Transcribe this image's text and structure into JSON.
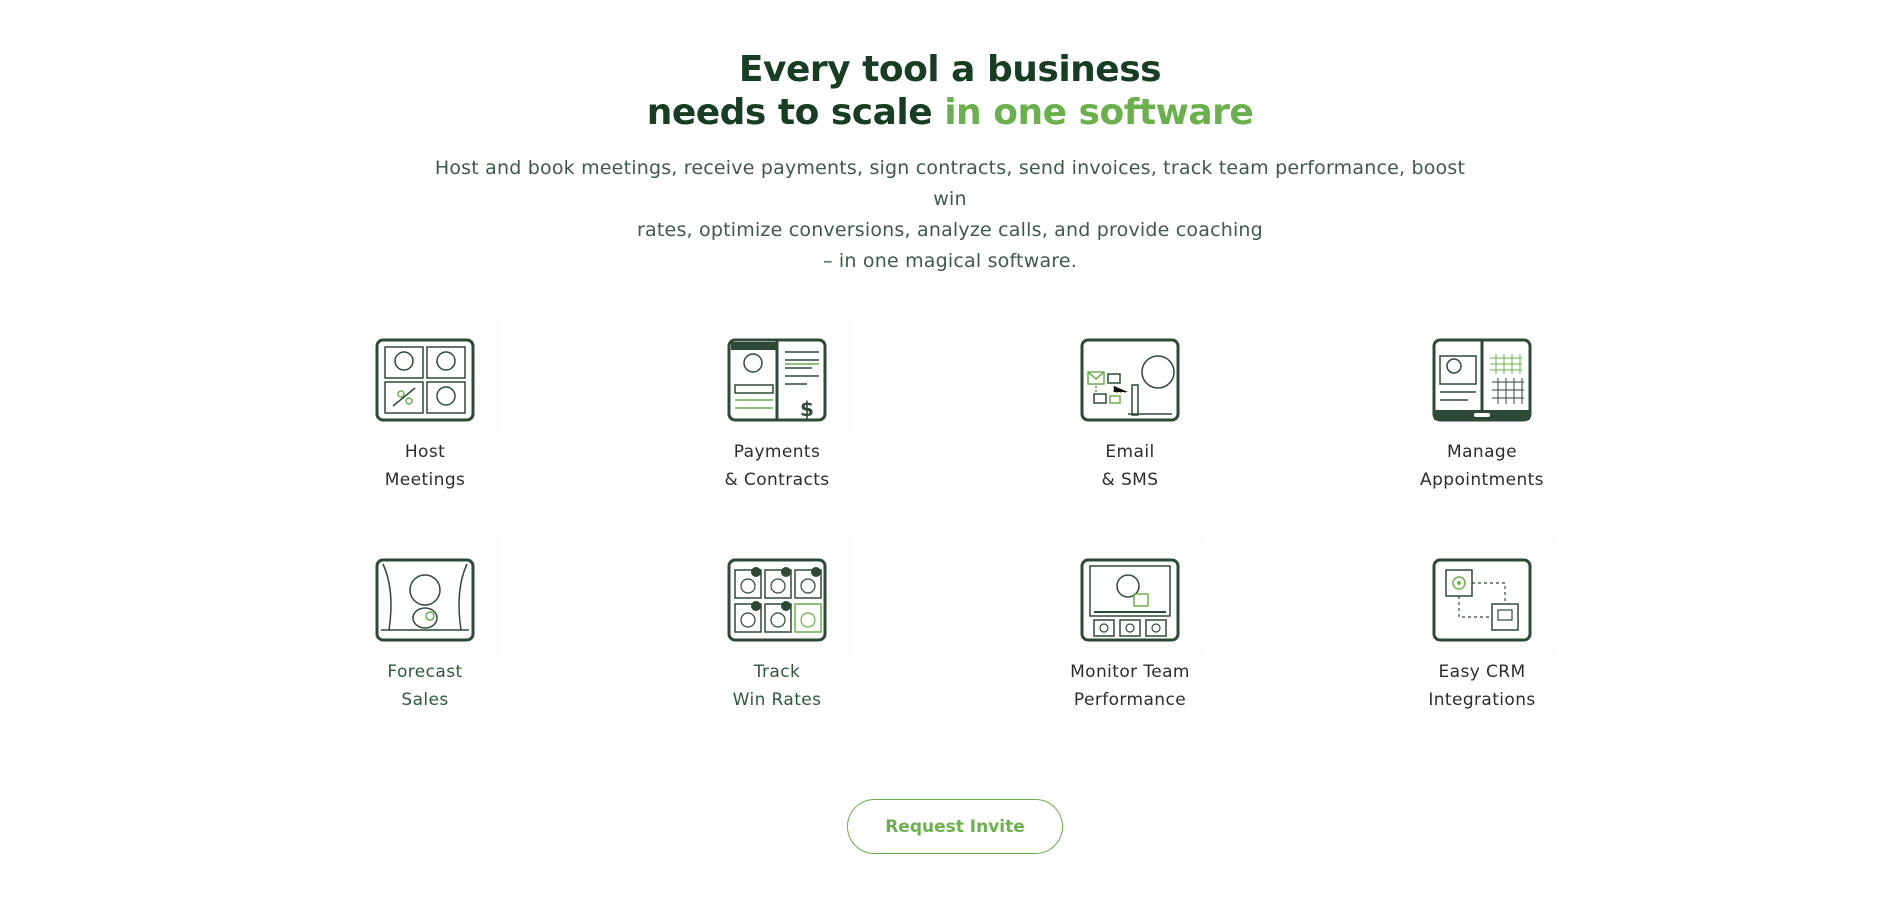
{
  "heading": {
    "line1": "Every tool a business",
    "line2_main": "needs to scale ",
    "line2_accent": "in one software"
  },
  "subtitle": {
    "line1": "Host and book meetings, receive payments, sign contracts, send invoices, track team performance, boost win",
    "line2": "rates, optimize conversions, analyze calls, and provide coaching",
    "line3": "– in one magical software."
  },
  "features": [
    {
      "icon": "host-meetings-icon",
      "line1": "Host",
      "line2": "Meetings"
    },
    {
      "icon": "payments-contracts-icon",
      "line1": "Payments",
      "line2": "& Contracts"
    },
    {
      "icon": "email-sms-icon",
      "line1": "Email",
      "line2": "& SMS"
    },
    {
      "icon": "manage-appointments-icon",
      "line1": "Manage",
      "line2": "Appointments"
    },
    {
      "icon": "forecast-sales-icon",
      "line1": "Forecast",
      "line2": "Sales"
    },
    {
      "icon": "track-win-rates-icon",
      "line1": "Track",
      "line2": "Win Rates"
    },
    {
      "icon": "monitor-team-icon",
      "line1": "Monitor Team",
      "line2": "Performance"
    },
    {
      "icon": "crm-integrations-icon",
      "line1": "Easy CRM",
      "line2": "Integrations"
    }
  ],
  "cta": {
    "label": "Request Invite"
  },
  "colors": {
    "dark_green": "#173d22",
    "accent_green": "#6ab04c",
    "text": "#3f5a48"
  }
}
